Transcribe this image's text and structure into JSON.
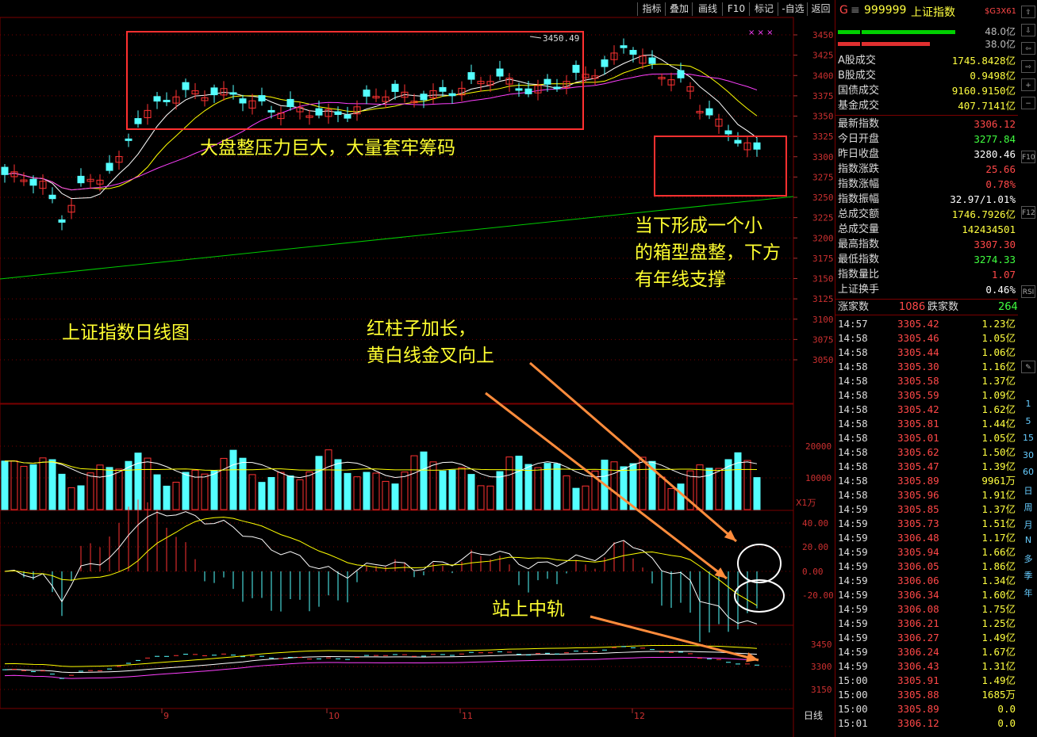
{
  "toolbar": {
    "buttons": [
      "指标",
      "叠加",
      "画线",
      "F10",
      "标记",
      "-自选",
      "返回"
    ]
  },
  "chart": {
    "price_axis": [
      "3450",
      "3425",
      "3400",
      "3375",
      "3350",
      "3325",
      "3300",
      "3275",
      "3250",
      "3225",
      "3200",
      "3175",
      "3150",
      "3125",
      "3100",
      "3075",
      "3050"
    ],
    "high_label": "3450.49",
    "volume_axis": [
      "20000",
      "10000"
    ],
    "volume_unit": "X1万",
    "macd_axis": [
      "40.00",
      "20.00",
      "0.00",
      "-20.00"
    ],
    "boll_axis": [
      "3450",
      "3300",
      "3150"
    ],
    "months": [
      "9",
      "10",
      "11",
      "12"
    ],
    "period_label": "日线",
    "colors": {
      "up": "#ff3232",
      "down": "#54ffff",
      "ma5": "#ffffff",
      "ma10": "#ffff00",
      "ma20": "#ff40ff",
      "ma250": "#00cc00",
      "annotation": "#ffff30",
      "arrow": "#ff8c3c"
    }
  },
  "annotations": {
    "box_top": "大盘整压力巨大，大量套牢筹码",
    "box_right": "当下形成一个小\n的箱型盘整，下方\n有年线支撑",
    "chart_title": "上证指数日线图",
    "macd_note": "红柱子加长，\n黄白线金叉向上",
    "boll_note": "站上中轨"
  },
  "quote": {
    "code_prefix": "G",
    "menu_icon": "≡",
    "code": "999999",
    "name": "上证指数",
    "tag": "$G3X61",
    "bar1_value": "48.0亿",
    "bar2_value": "38.0亿",
    "turnover": [
      {
        "label": "A股成交",
        "value": "1745.8428亿"
      },
      {
        "label": "B股成交",
        "value": "0.9498亿"
      },
      {
        "label": "国债成交",
        "value": "9160.9150亿"
      },
      {
        "label": "基金成交",
        "value": "407.7141亿"
      }
    ],
    "stats": [
      {
        "label": "最新指数",
        "value": "3306.12",
        "color": "#ff4848"
      },
      {
        "label": "今日开盘",
        "value": "3277.84",
        "color": "#40ff40"
      },
      {
        "label": "昨日收盘",
        "value": "3280.46",
        "color": "#ffffff"
      },
      {
        "label": "指数涨跌",
        "value": "25.66",
        "color": "#ff4848"
      },
      {
        "label": "指数涨幅",
        "value": "0.78%",
        "color": "#ff4848"
      },
      {
        "label": "指数振幅",
        "value": "32.97/1.01%",
        "color": "#ffffff"
      },
      {
        "label": "总成交额",
        "value": "1746.7926亿",
        "color": "#ffff40"
      },
      {
        "label": "总成交量",
        "value": "142434501",
        "color": "#ffff40"
      },
      {
        "label": "最高指数",
        "value": "3307.30",
        "color": "#ff4848"
      },
      {
        "label": "最低指数",
        "value": "3274.33",
        "color": "#40ff40"
      },
      {
        "label": "指数量比",
        "value": "1.07",
        "color": "#ff4848"
      },
      {
        "label": "上证换手",
        "value": "0.46%",
        "color": "#ffffff"
      }
    ],
    "adv_label": "涨家数",
    "adv_value": "1086",
    "dec_label": "跌家数",
    "dec_value": "264"
  },
  "ticks": [
    {
      "t": "14:57",
      "p": "3305.42",
      "v": "1.23亿"
    },
    {
      "t": "14:58",
      "p": "3305.46",
      "v": "1.05亿"
    },
    {
      "t": "14:58",
      "p": "3305.44",
      "v": "1.06亿"
    },
    {
      "t": "14:58",
      "p": "3305.30",
      "v": "1.16亿"
    },
    {
      "t": "14:58",
      "p": "3305.58",
      "v": "1.37亿"
    },
    {
      "t": "14:58",
      "p": "3305.59",
      "v": "1.09亿"
    },
    {
      "t": "14:58",
      "p": "3305.42",
      "v": "1.62亿"
    },
    {
      "t": "14:58",
      "p": "3305.81",
      "v": "1.44亿"
    },
    {
      "t": "14:58",
      "p": "3305.01",
      "v": "1.05亿"
    },
    {
      "t": "14:58",
      "p": "3305.62",
      "v": "1.50亿"
    },
    {
      "t": "14:58",
      "p": "3305.47",
      "v": "1.39亿"
    },
    {
      "t": "14:58",
      "p": "3305.89",
      "v": "9961万"
    },
    {
      "t": "14:58",
      "p": "3305.96",
      "v": "1.91亿"
    },
    {
      "t": "14:59",
      "p": "3305.85",
      "v": "1.37亿"
    },
    {
      "t": "14:59",
      "p": "3305.73",
      "v": "1.51亿"
    },
    {
      "t": "14:59",
      "p": "3306.48",
      "v": "1.17亿"
    },
    {
      "t": "14:59",
      "p": "3305.94",
      "v": "1.66亿"
    },
    {
      "t": "14:59",
      "p": "3306.05",
      "v": "1.86亿"
    },
    {
      "t": "14:59",
      "p": "3306.06",
      "v": "1.34亿"
    },
    {
      "t": "14:59",
      "p": "3306.34",
      "v": "1.60亿"
    },
    {
      "t": "14:59",
      "p": "3306.08",
      "v": "1.75亿"
    },
    {
      "t": "14:59",
      "p": "3306.21",
      "v": "1.25亿"
    },
    {
      "t": "14:59",
      "p": "3306.27",
      "v": "1.49亿"
    },
    {
      "t": "14:59",
      "p": "3306.24",
      "v": "1.67亿"
    },
    {
      "t": "14:59",
      "p": "3306.43",
      "v": "1.31亿"
    },
    {
      "t": "15:00",
      "p": "3305.91",
      "v": "1.49亿"
    },
    {
      "t": "15:00",
      "p": "3305.88",
      "v": "1685万"
    },
    {
      "t": "15:00",
      "p": "3305.89",
      "v": "0.0"
    },
    {
      "t": "15:01",
      "p": "3306.12",
      "v": "0.0"
    }
  ],
  "sidebar": {
    "periods": [
      "1",
      "5",
      "15",
      "30",
      "60",
      "日",
      "周",
      "月",
      "N",
      "多",
      "季",
      "年"
    ],
    "icons": [
      "up-arrow-icon",
      "down-arrow-icon",
      "left-arrow-icon",
      "right-arrow-icon",
      "zoom-in-icon",
      "zoom-out-icon",
      "f10-icon",
      "f12-icon",
      "rsi-icon",
      "pencil-icon"
    ]
  }
}
